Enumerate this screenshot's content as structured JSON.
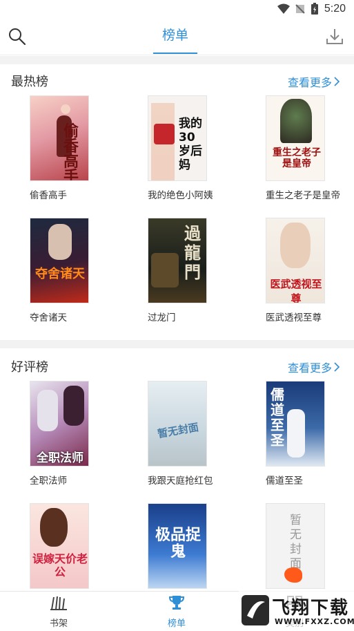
{
  "status": {
    "time": "5:20"
  },
  "header": {
    "title": "榜单"
  },
  "sections": [
    {
      "title": "最热榜",
      "more": "查看更多",
      "books": [
        {
          "title": "偷香高手",
          "cover_text": "偷香高手"
        },
        {
          "title": "我的绝色小阿姨",
          "cover_text": "我的30岁后妈"
        },
        {
          "title": "重生之老子是皇帝",
          "cover_text": "重生之老子是皇帝"
        },
        {
          "title": "夺舍诸天",
          "cover_text": "夺舍诸天"
        },
        {
          "title": "过龙门",
          "cover_text": "過龍門"
        },
        {
          "title": "医武透视至尊",
          "cover_text": "医武透视至尊"
        }
      ]
    },
    {
      "title": "好评榜",
      "more": "查看更多",
      "books": [
        {
          "title": "全职法师",
          "cover_text": "全职法师"
        },
        {
          "title": "我跟天庭抢红包",
          "cover_text": "暂无封面"
        },
        {
          "title": "儒道至圣",
          "cover_text": "儒道至圣"
        },
        {
          "title": "",
          "cover_text": "误嫁天价老公"
        },
        {
          "title": "",
          "cover_text": "极品捉鬼"
        },
        {
          "title": "",
          "cover_text": "暂无封面"
        }
      ]
    }
  ],
  "tabbar": {
    "tabs": [
      {
        "label": "书架"
      },
      {
        "label": "榜单"
      },
      {
        "label": "类别"
      }
    ]
  },
  "watermark": {
    "text": "飞翔下载",
    "url": "WWW.FXXZ.COM"
  }
}
